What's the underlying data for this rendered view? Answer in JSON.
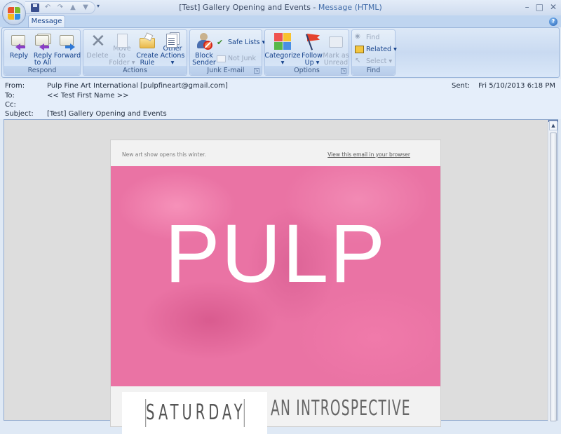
{
  "window": {
    "title_subject": "[Test] Gallery Opening and Events",
    "title_app": "Message (HTML)",
    "title_separator": " - ",
    "controls": [
      "minimize",
      "maximize",
      "close"
    ]
  },
  "quick_access": [
    "save-icon",
    "undo-icon",
    "redo-icon",
    "previous-item-icon",
    "next-item-icon"
  ],
  "tabs": [
    {
      "label": "Message",
      "active": true
    }
  ],
  "ribbon": {
    "groups": {
      "respond": {
        "label": "Respond",
        "buttons": [
          {
            "label": "Reply",
            "icon": "reply-icon",
            "enabled": true
          },
          {
            "label": "Reply to All",
            "line1": "Reply",
            "line2": "to All",
            "icon": "reply-all-icon",
            "enabled": true
          },
          {
            "label": "Forward",
            "icon": "forward-icon",
            "enabled": true
          }
        ]
      },
      "actions": {
        "label": "Actions",
        "buttons": [
          {
            "label": "Delete",
            "icon": "delete-icon",
            "enabled": false
          },
          {
            "label": "Move to Folder",
            "line1": "Move to",
            "line2": "Folder ▾",
            "icon": "move-to-folder-icon",
            "enabled": false
          },
          {
            "label": "Create Rule",
            "line1": "Create",
            "line2": "Rule",
            "icon": "create-rule-icon",
            "enabled": true
          },
          {
            "label": "Other Actions",
            "line1": "Other",
            "line2": "Actions ▾",
            "icon": "other-actions-icon",
            "enabled": true
          }
        ]
      },
      "junk": {
        "label": "Junk E-mail",
        "block_line1": "Block",
        "block_line2": "Sender",
        "safe_lists": "Safe Lists ▾",
        "not_junk": "Not Junk"
      },
      "options": {
        "label": "Options",
        "categorize_line1": "Categorize",
        "categorize_line2": "▾",
        "follow_line1": "Follow",
        "follow_line2": "Up ▾",
        "mark_line1": "Mark as",
        "mark_line2": "Unread"
      },
      "find": {
        "label": "Find",
        "find": "Find",
        "related": "Related ▾",
        "select": "Select ▾"
      }
    }
  },
  "message_header": {
    "from_label": "From:",
    "from_value": "Pulp Fine Art International [pulpfineart@gmail.com]",
    "to_label": "To:",
    "to_value": "<< Test First Name >>",
    "cc_label": "Cc:",
    "cc_value": "",
    "subject_label": "Subject:",
    "subject_value": "[Test] Gallery Opening and Events",
    "sent_label": "Sent:",
    "sent_value": "Fri 5/10/2013 6:18 PM"
  },
  "email_body": {
    "preheader": "New art show opens this  winter.",
    "view_in_browser": "View this email in your browser",
    "hero_title": "PULP",
    "hero_color": "#ea73a4",
    "day_label": "SATURDAY",
    "headline": "AN INTROSPECTIVE"
  },
  "colors": {
    "ribbon_text": "#15428b",
    "disabled_text": "#9aa8bd",
    "hero_pink": "#ea73a4"
  }
}
